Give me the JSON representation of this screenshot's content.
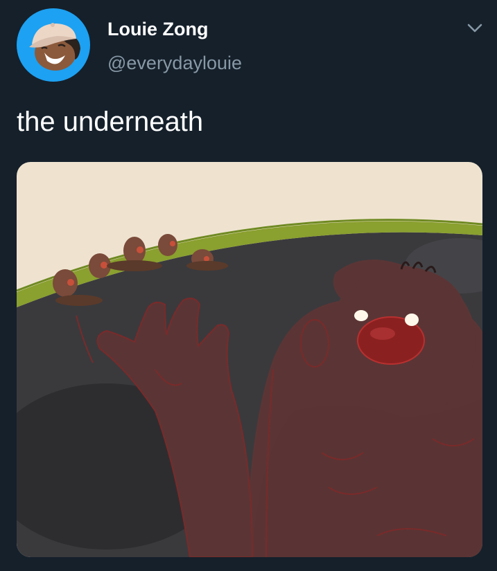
{
  "tweet": {
    "author": {
      "display_name": "Louie Zong",
      "handle": "@everydaylouie",
      "avatar_icon": "cartoon-avatar-icon",
      "avatar_bg": "#1da1f2"
    },
    "text": "the underneath",
    "menu_icon": "chevron-down-icon",
    "media": {
      "kind": "illustration",
      "alt": ""
    }
  },
  "colors": {
    "background": "#15202b",
    "primary_text": "#ffffff",
    "secondary_text": "#8899a6"
  }
}
